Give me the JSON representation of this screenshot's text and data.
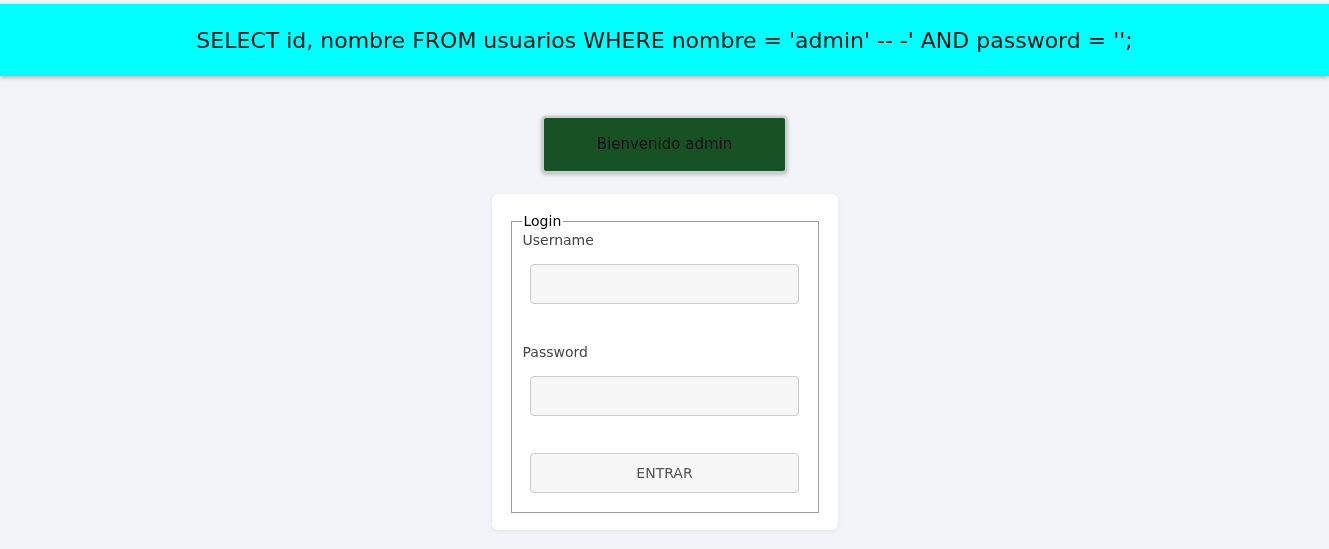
{
  "query_banner": {
    "text": "SELECT id, nombre FROM usuarios WHERE nombre = 'admin' -- -' AND password = '';"
  },
  "message": {
    "text": "Bienvenido admin"
  },
  "login_form": {
    "legend": "Login",
    "fields": [
      {
        "label": "Username"
      },
      {
        "label": "Password"
      }
    ],
    "submit": {
      "label": "ENTRAR"
    }
  }
}
